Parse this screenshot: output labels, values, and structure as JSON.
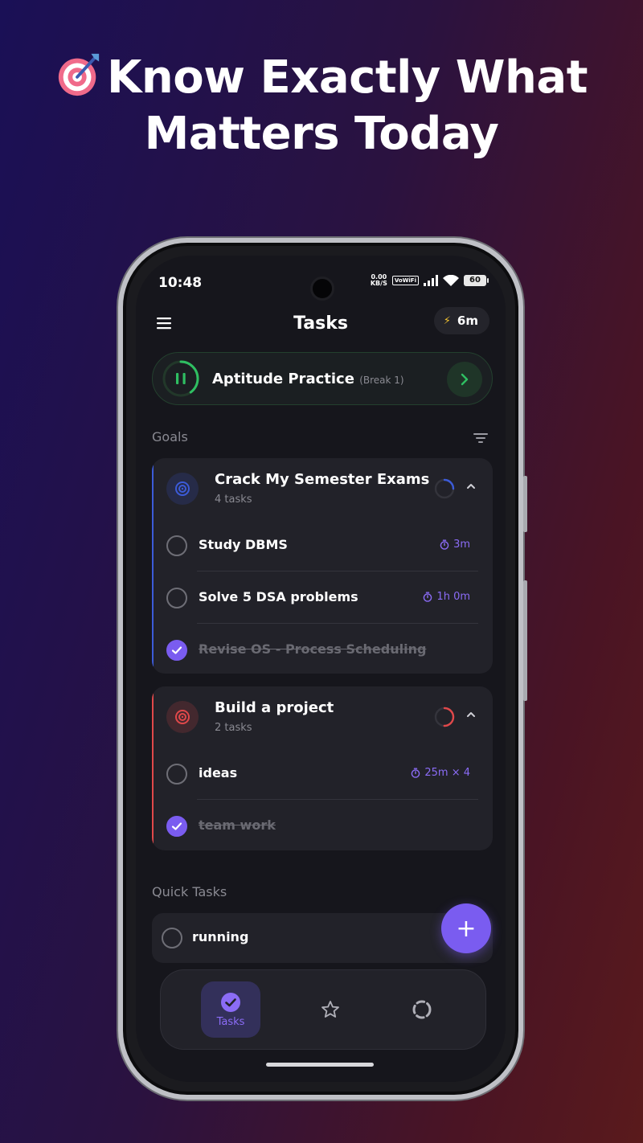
{
  "promo": {
    "headline_line1": "Know Exactly What",
    "headline_line2": "Matters Today",
    "emoji": "target-emoji"
  },
  "status_bar": {
    "time": "10:48",
    "net_speed_value": "0.00",
    "net_speed_unit": "KB/S",
    "vowifi": "VoWiFi",
    "battery": "60"
  },
  "header": {
    "title": "Tasks",
    "streak": "6m"
  },
  "timer": {
    "title": "Aptitude Practice",
    "subtitle": "(Break 1)",
    "progress": 0.4,
    "color": "#2fbf62"
  },
  "goals_section": {
    "label": "Goals"
  },
  "goals": [
    {
      "title": "Crack My Semester Exams",
      "count": "4 tasks",
      "accent": "#3c5bd8",
      "progress": 0.25,
      "tasks": [
        {
          "title": "Study DBMS",
          "duration": "3m",
          "done": false
        },
        {
          "title": "Solve 5 DSA problems",
          "duration": "1h 0m",
          "done": false
        },
        {
          "title": "Revise OS - Process Scheduling",
          "duration": "",
          "done": true
        }
      ]
    },
    {
      "title": "Build a project",
      "count": "2 tasks",
      "accent": "#e0484a",
      "progress": 0.5,
      "tasks": [
        {
          "title": "ideas",
          "duration": "25m × 4",
          "done": false
        },
        {
          "title": "team work",
          "duration": "",
          "done": true
        }
      ]
    }
  ],
  "quick_section": {
    "label": "Quick Tasks"
  },
  "quick_tasks": [
    {
      "title": "running",
      "done": false
    }
  ],
  "fab": {
    "label": "+"
  },
  "nav": {
    "tasks_label": "Tasks",
    "active": "tasks",
    "accent": "#7a5cf0"
  }
}
